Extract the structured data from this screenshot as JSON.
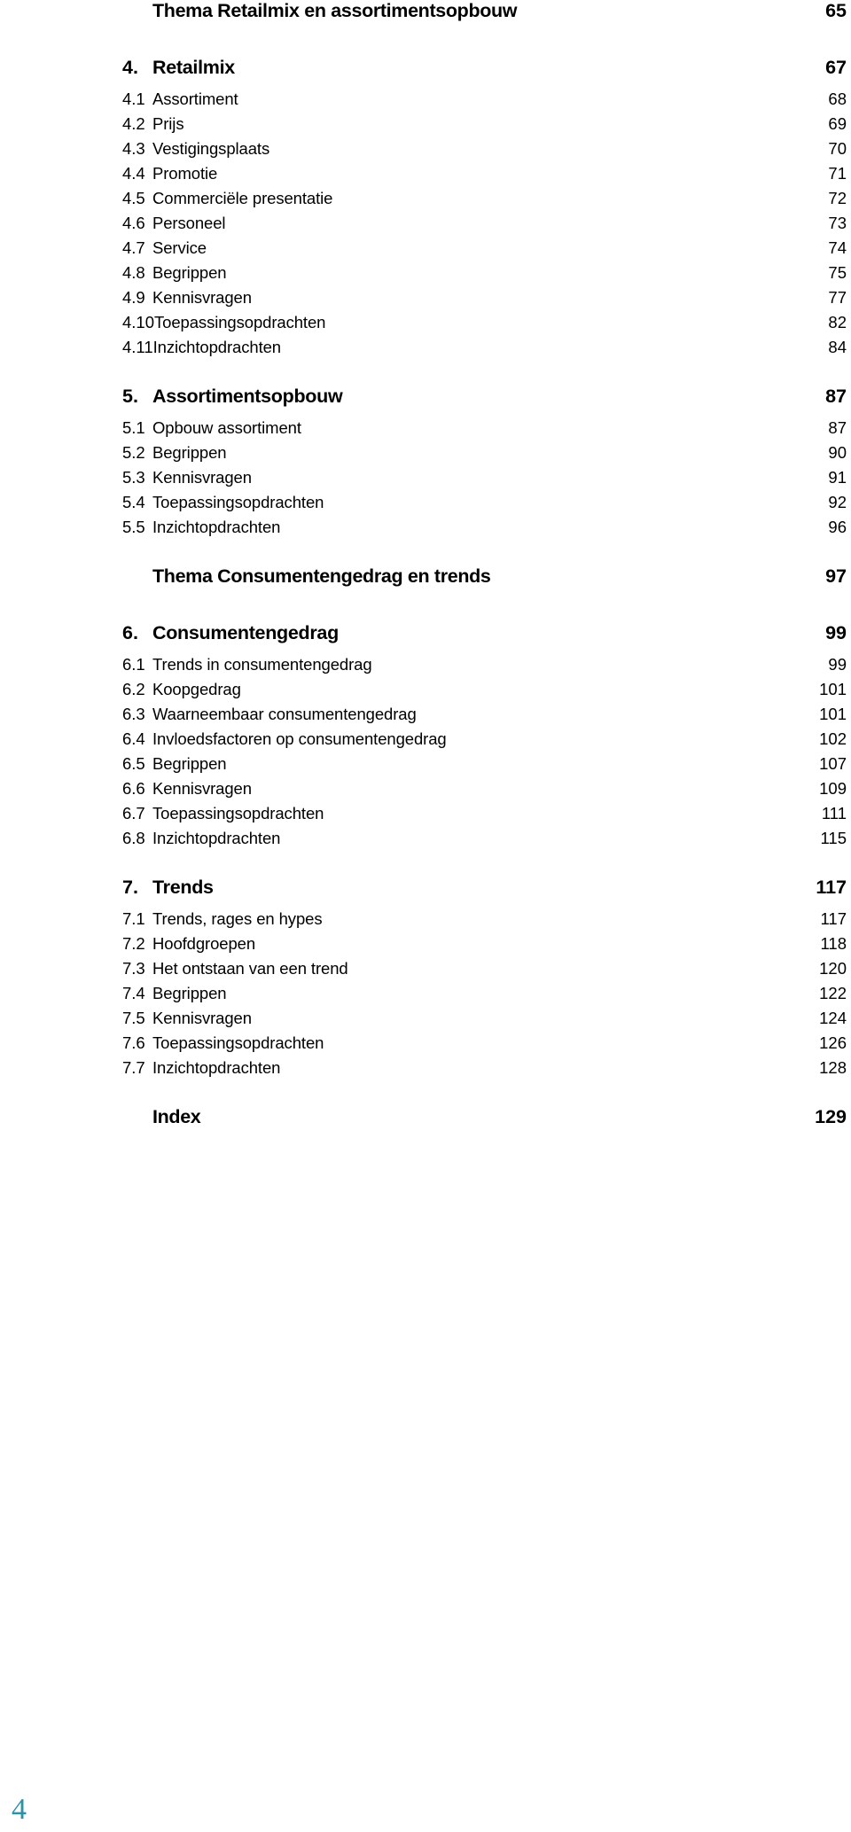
{
  "document": {
    "type": "table-of-contents",
    "folio": "4",
    "folio_color": "#2d92a6",
    "text_color": "#000000",
    "background": "#ffffff"
  },
  "entries": [
    {
      "kind": "theme",
      "num": "",
      "title": "Thema Retailmix en assortimentsopbouw",
      "page": "65"
    },
    {
      "kind": "gap-md",
      "num": "",
      "title": "",
      "page": ""
    },
    {
      "kind": "chapter",
      "num": "4.",
      "title": "Retailmix",
      "page": "67"
    },
    {
      "kind": "sub",
      "num": "4.1",
      "title": "Assortiment",
      "page": "68"
    },
    {
      "kind": "sub",
      "num": "4.2",
      "title": "Prijs",
      "page": "69"
    },
    {
      "kind": "sub",
      "num": "4.3",
      "title": "Vestigingsplaats",
      "page": "70"
    },
    {
      "kind": "sub",
      "num": "4.4",
      "title": "Promotie",
      "page": "71"
    },
    {
      "kind": "sub",
      "num": "4.5",
      "title": "Commerciële presentatie",
      "page": "72"
    },
    {
      "kind": "sub",
      "num": "4.6",
      "title": "Personeel",
      "page": "73"
    },
    {
      "kind": "sub",
      "num": "4.7",
      "title": "Service",
      "page": "74"
    },
    {
      "kind": "sub",
      "num": "4.8",
      "title": "Begrippen",
      "page": "75"
    },
    {
      "kind": "sub",
      "num": "4.9",
      "title": "Kennisvragen",
      "page": "77"
    },
    {
      "kind": "sub",
      "num": "4.10",
      "title": "Toepassingsopdrachten",
      "page": "82"
    },
    {
      "kind": "sub",
      "num": "4.11",
      "title": "Inzichtopdrachten",
      "page": "84"
    },
    {
      "kind": "gap-md",
      "num": "",
      "title": "",
      "page": ""
    },
    {
      "kind": "chapter",
      "num": "5.",
      "title": "Assortimentsopbouw",
      "page": "87"
    },
    {
      "kind": "sub",
      "num": "5.1",
      "title": "Opbouw assortiment",
      "page": "87"
    },
    {
      "kind": "sub",
      "num": "5.2",
      "title": "Begrippen",
      "page": "90"
    },
    {
      "kind": "sub",
      "num": "5.3",
      "title": "Kennisvragen",
      "page": "91"
    },
    {
      "kind": "sub",
      "num": "5.4",
      "title": "Toepassingsopdrachten",
      "page": "92"
    },
    {
      "kind": "sub",
      "num": "5.5",
      "title": "Inzichtopdrachten",
      "page": "96"
    },
    {
      "kind": "gap-md",
      "num": "",
      "title": "",
      "page": ""
    },
    {
      "kind": "theme",
      "num": "",
      "title": "Thema Consumentengedrag en trends",
      "page": "97"
    },
    {
      "kind": "gap-md",
      "num": "",
      "title": "",
      "page": ""
    },
    {
      "kind": "chapter",
      "num": "6.",
      "title": "Consumentengedrag",
      "page": "99"
    },
    {
      "kind": "sub",
      "num": "6.1",
      "title": "Trends in consumentengedrag",
      "page": "99"
    },
    {
      "kind": "sub",
      "num": "6.2",
      "title": "Koopgedrag",
      "page": "101"
    },
    {
      "kind": "sub",
      "num": "6.3",
      "title": "Waarneembaar consumentengedrag",
      "page": "101"
    },
    {
      "kind": "sub",
      "num": "6.4",
      "title": "Invloedsfactoren op consumentengedrag",
      "page": "102"
    },
    {
      "kind": "sub",
      "num": "6.5",
      "title": "Begrippen",
      "page": "107"
    },
    {
      "kind": "sub",
      "num": "6.6",
      "title": "Kennisvragen",
      "page": "109"
    },
    {
      "kind": "sub",
      "num": "6.7",
      "title": "Toepassingsopdrachten",
      "page": "111"
    },
    {
      "kind": "sub",
      "num": "6.8",
      "title": "Inzichtopdrachten",
      "page": "115"
    },
    {
      "kind": "gap-md",
      "num": "",
      "title": "",
      "page": ""
    },
    {
      "kind": "chapter",
      "num": "7.",
      "title": "Trends",
      "page": "117"
    },
    {
      "kind": "sub",
      "num": "7.1",
      "title": "Trends, rages en hypes",
      "page": "117"
    },
    {
      "kind": "sub",
      "num": "7.2",
      "title": "Hoofdgroepen",
      "page": "118"
    },
    {
      "kind": "sub",
      "num": "7.3",
      "title": "Het ontstaan van een trend",
      "page": "120"
    },
    {
      "kind": "sub",
      "num": "7.4",
      "title": "Begrippen",
      "page": "122"
    },
    {
      "kind": "sub",
      "num": "7.5",
      "title": "Kennisvragen",
      "page": "124"
    },
    {
      "kind": "sub",
      "num": "7.6",
      "title": "Toepassingsopdrachten",
      "page": "126"
    },
    {
      "kind": "sub",
      "num": "7.7",
      "title": "Inzichtopdrachten",
      "page": "128"
    },
    {
      "kind": "gap-md",
      "num": "",
      "title": "",
      "page": ""
    },
    {
      "kind": "theme",
      "num": "",
      "title": "Index",
      "page": "129"
    }
  ]
}
